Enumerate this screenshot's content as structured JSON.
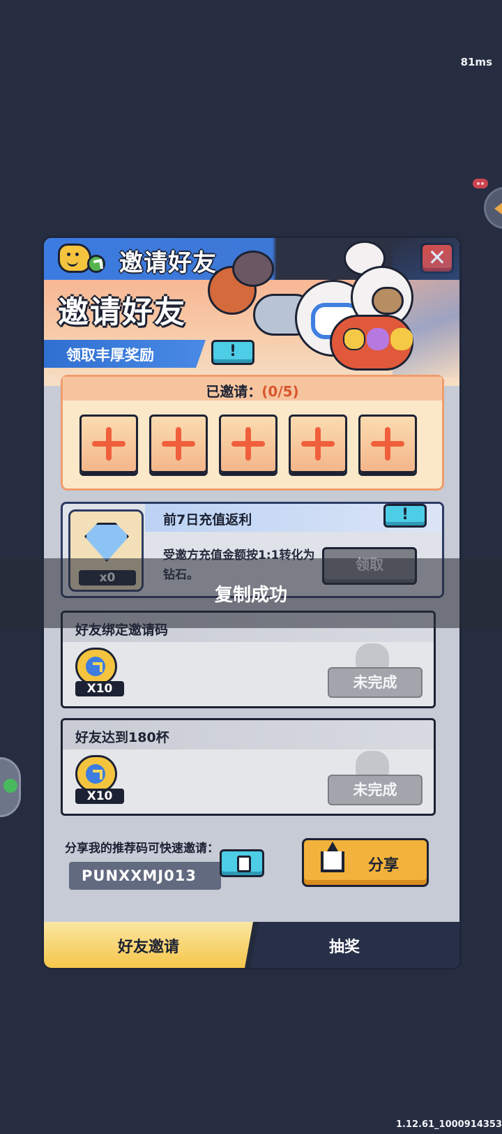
{
  "status": {
    "latency": "81ms",
    "build": "1.12.61_1000914353"
  },
  "header": {
    "title": "邀请好友"
  },
  "banner": {
    "title": "邀请好友",
    "subtitle": "领取丰厚奖励",
    "info_symbol": "!"
  },
  "invited": {
    "label": "已邀请：",
    "count": "(0/5)",
    "slots": 5
  },
  "rebate": {
    "title": "前7日充值返利",
    "desc": "受邀方充值金额按1:1转化为钻石。",
    "gem_count": "x0",
    "claim_label": "领取",
    "info_symbol": "!"
  },
  "toast": {
    "text": "复制成功"
  },
  "tasks": [
    {
      "title": "好友绑定邀请码",
      "reward": "X10",
      "status": "未完成"
    },
    {
      "title": "好友达到180杯",
      "reward": "X10",
      "status": "未完成"
    }
  ],
  "share": {
    "label": "分享我的推荐码可快速邀请：",
    "code": "PUNXXMJ013",
    "button": "分享"
  },
  "tabs": [
    {
      "label": "好友邀请",
      "active": true
    },
    {
      "label": "抽奖",
      "active": false
    }
  ],
  "colors": {
    "background": "#272d41",
    "accent_orange": "#f05f3b",
    "button_cyan": "#4ecde6",
    "share_gold": "#f3b23b"
  }
}
